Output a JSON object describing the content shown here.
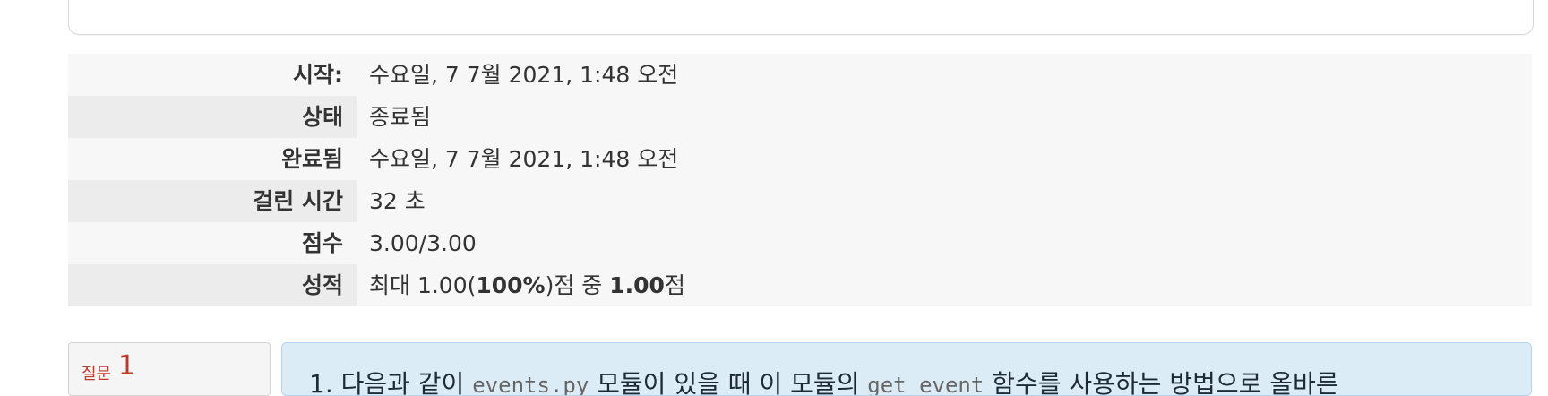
{
  "summary": {
    "rows": [
      {
        "label": "시작:",
        "value": "수요일, 7 7월 2021, 1:48 오전"
      },
      {
        "label": "상태",
        "value": "종료됨"
      },
      {
        "label": "완료됨",
        "value": "수요일, 7 7월 2021, 1:48 오전"
      },
      {
        "label": "걸린 시간",
        "value": "32 초"
      },
      {
        "label": "점수",
        "value": "3.00/3.00"
      },
      {
        "label": "성적",
        "value_prefix": "최대 1.00(",
        "value_pct": "100%",
        "value_mid": ")점 중 ",
        "value_score": "1.00",
        "value_suffix": "점"
      }
    ]
  },
  "question": {
    "label": "질문",
    "number": "1",
    "text_part1": "1. 다음과 같이 ",
    "code1": "events.py",
    "text_part2": " 모듈이 있을 때 이 모듈의 ",
    "code2": "get_event",
    "text_part3": " 함수를 사용하는 방법으로 올바른"
  }
}
